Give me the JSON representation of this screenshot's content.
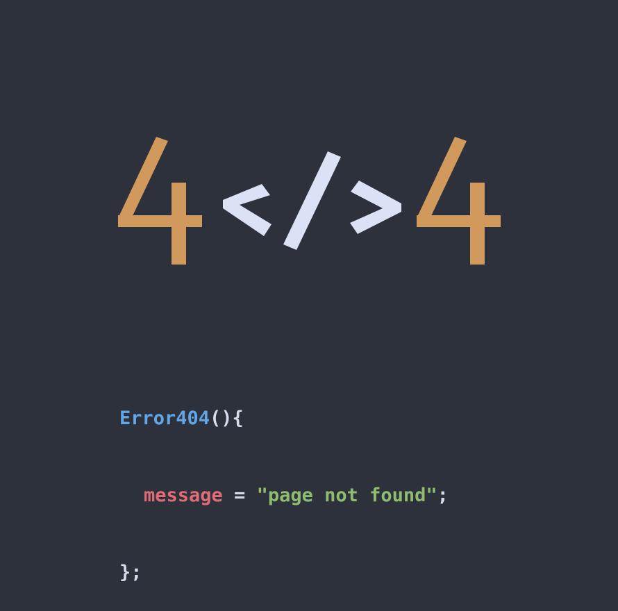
{
  "hero": {
    "left_digit": "4",
    "right_digit": "4",
    "symbol": "</>"
  },
  "code": {
    "function_name": "Error404",
    "parens_brace": "(){",
    "property": "message",
    "operator": " = ",
    "string_value": "\"page not found\"",
    "semicolon": ";",
    "closing": "};"
  },
  "colors": {
    "background": "#2c313c",
    "digit": "#d19a5c",
    "symbol": "#dbe2f5",
    "function": "#62a6e8",
    "property": "#e06c75",
    "string": "#8fbc6e",
    "punctuation": "#d5dcec"
  }
}
